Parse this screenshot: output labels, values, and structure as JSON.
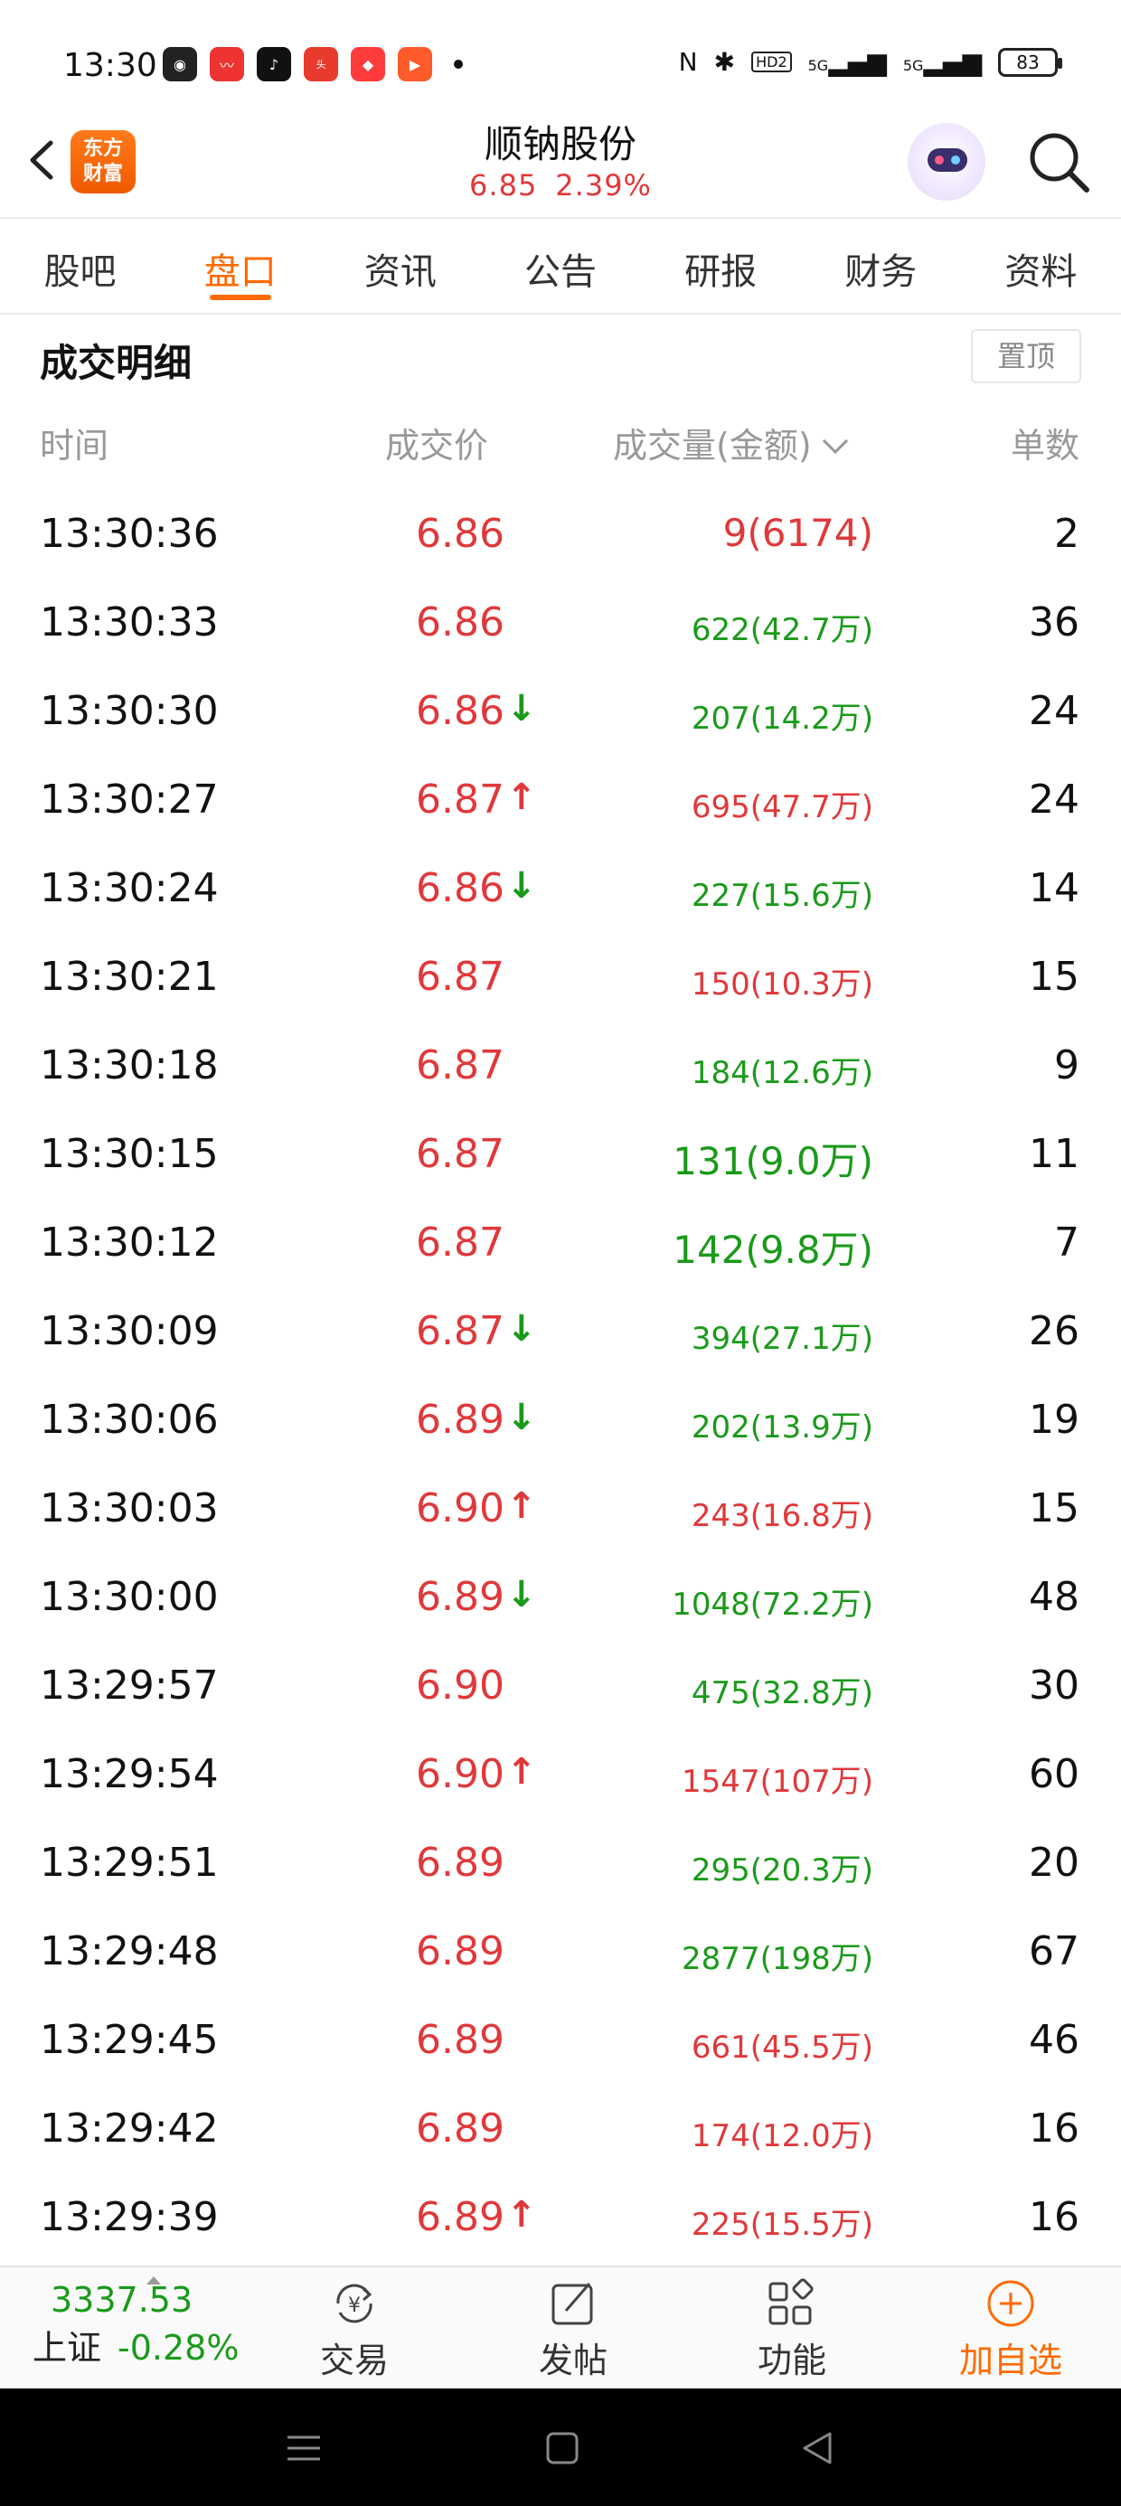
{
  "status_bar": {
    "time": "13:30",
    "app_icons": [
      "bilibili-icon",
      "stock-app-icon",
      "tiktok-icon",
      "toutiao-icon",
      "shopping-icon",
      "video-icon"
    ],
    "nfc": "N",
    "bluetooth": "✱",
    "hd": "HD2",
    "signal1": "5G",
    "signal2": "5G",
    "battery": "83"
  },
  "header": {
    "logo_line1": "东方",
    "logo_line2": "财富",
    "title": "顺钠股份",
    "price": "6.85",
    "change_pct": "2.39%"
  },
  "tabs": [
    {
      "label": "股吧",
      "active": false
    },
    {
      "label": "盘口",
      "active": true
    },
    {
      "label": "资讯",
      "active": false
    },
    {
      "label": "公告",
      "active": false
    },
    {
      "label": "研报",
      "active": false
    },
    {
      "label": "财务",
      "active": false
    },
    {
      "label": "资料",
      "active": false
    }
  ],
  "section": {
    "title": "成交明细",
    "pin_label": "置顶",
    "columns": {
      "time": "时间",
      "price": "成交价",
      "volume": "成交量(金额)",
      "count": "单数"
    }
  },
  "colors": {
    "up": "#e0383a",
    "down": "#1a9a1a",
    "accent": "#ff6a00"
  },
  "trades": [
    {
      "time": "13:30:36",
      "price": "6.86",
      "arrow": "",
      "volume": "9(6174)",
      "vol_color": "red",
      "big": true,
      "count": "2"
    },
    {
      "time": "13:30:33",
      "price": "6.86",
      "arrow": "",
      "volume": "622(42.7万)",
      "vol_color": "green",
      "big": false,
      "count": "36"
    },
    {
      "time": "13:30:30",
      "price": "6.86",
      "arrow": "↓",
      "volume": "207(14.2万)",
      "vol_color": "green",
      "big": false,
      "count": "24"
    },
    {
      "time": "13:30:27",
      "price": "6.87",
      "arrow": "↑",
      "volume": "695(47.7万)",
      "vol_color": "red",
      "big": false,
      "count": "24"
    },
    {
      "time": "13:30:24",
      "price": "6.86",
      "arrow": "↓",
      "volume": "227(15.6万)",
      "vol_color": "green",
      "big": false,
      "count": "14"
    },
    {
      "time": "13:30:21",
      "price": "6.87",
      "arrow": "",
      "volume": "150(10.3万)",
      "vol_color": "red",
      "big": false,
      "count": "15"
    },
    {
      "time": "13:30:18",
      "price": "6.87",
      "arrow": "",
      "volume": "184(12.6万)",
      "vol_color": "green",
      "big": false,
      "count": "9"
    },
    {
      "time": "13:30:15",
      "price": "6.87",
      "arrow": "",
      "volume": "131(9.0万)",
      "vol_color": "green",
      "big": true,
      "count": "11"
    },
    {
      "time": "13:30:12",
      "price": "6.87",
      "arrow": "",
      "volume": "142(9.8万)",
      "vol_color": "green",
      "big": true,
      "count": "7"
    },
    {
      "time": "13:30:09",
      "price": "6.87",
      "arrow": "↓",
      "volume": "394(27.1万)",
      "vol_color": "green",
      "big": false,
      "count": "26"
    },
    {
      "time": "13:30:06",
      "price": "6.89",
      "arrow": "↓",
      "volume": "202(13.9万)",
      "vol_color": "green",
      "big": false,
      "count": "19"
    },
    {
      "time": "13:30:03",
      "price": "6.90",
      "arrow": "↑",
      "volume": "243(16.8万)",
      "vol_color": "red",
      "big": false,
      "count": "15"
    },
    {
      "time": "13:30:00",
      "price": "6.89",
      "arrow": "↓",
      "volume": "1048(72.2万)",
      "vol_color": "green",
      "big": false,
      "count": "48"
    },
    {
      "time": "13:29:57",
      "price": "6.90",
      "arrow": "",
      "volume": "475(32.8万)",
      "vol_color": "green",
      "big": false,
      "count": "30"
    },
    {
      "time": "13:29:54",
      "price": "6.90",
      "arrow": "↑",
      "volume": "1547(107万)",
      "vol_color": "red",
      "big": false,
      "count": "60"
    },
    {
      "time": "13:29:51",
      "price": "6.89",
      "arrow": "",
      "volume": "295(20.3万)",
      "vol_color": "green",
      "big": false,
      "count": "20"
    },
    {
      "time": "13:29:48",
      "price": "6.89",
      "arrow": "",
      "volume": "2877(198万)",
      "vol_color": "green",
      "big": false,
      "count": "67"
    },
    {
      "time": "13:29:45",
      "price": "6.89",
      "arrow": "",
      "volume": "661(45.5万)",
      "vol_color": "red",
      "big": false,
      "count": "46"
    },
    {
      "time": "13:29:42",
      "price": "6.89",
      "arrow": "",
      "volume": "174(12.0万)",
      "vol_color": "red",
      "big": false,
      "count": "16"
    },
    {
      "time": "13:29:39",
      "price": "6.89",
      "arrow": "↑",
      "volume": "225(15.5万)",
      "vol_color": "red",
      "big": false,
      "count": "16"
    }
  ],
  "bottom_bar": {
    "index_value": "3337.53",
    "index_name": "上证",
    "index_change": "-0.28%",
    "items": [
      {
        "label": "交易",
        "icon": "yuan-exchange-icon"
      },
      {
        "label": "发帖",
        "icon": "edit-post-icon"
      },
      {
        "label": "功能",
        "icon": "grid-apps-icon"
      },
      {
        "label": "加自选",
        "icon": "add-circle-icon"
      }
    ]
  },
  "nav_bar": {
    "icons": [
      "menu-icon",
      "home-icon",
      "back-icon"
    ]
  }
}
